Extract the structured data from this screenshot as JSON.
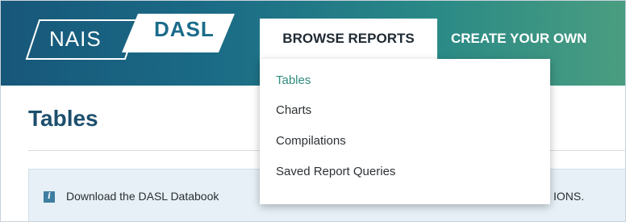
{
  "brand": {
    "logo_left": "NAIS",
    "logo_right": "DASL"
  },
  "nav": {
    "browse_reports": "BROWSE REPORTS",
    "create_your_own": "CREATE YOUR OWN"
  },
  "dropdown": {
    "items": [
      {
        "label": "Tables",
        "active": true
      },
      {
        "label": "Charts",
        "active": false
      },
      {
        "label": "Compilations",
        "active": false
      },
      {
        "label": "Saved Report Queries",
        "active": false
      }
    ]
  },
  "page": {
    "title": "Tables"
  },
  "notice": {
    "icon": "info-icon",
    "icon_glyph": "i",
    "text_visible_start": "Download the DASL Databook",
    "text_visible_end": "IONS."
  },
  "colors": {
    "header_gradient_start": "#17577a",
    "header_gradient_end": "#4a9d80",
    "title": "#1d4f6d",
    "active_menu": "#2f8c7e",
    "notice_bg": "#e6f0f6"
  }
}
